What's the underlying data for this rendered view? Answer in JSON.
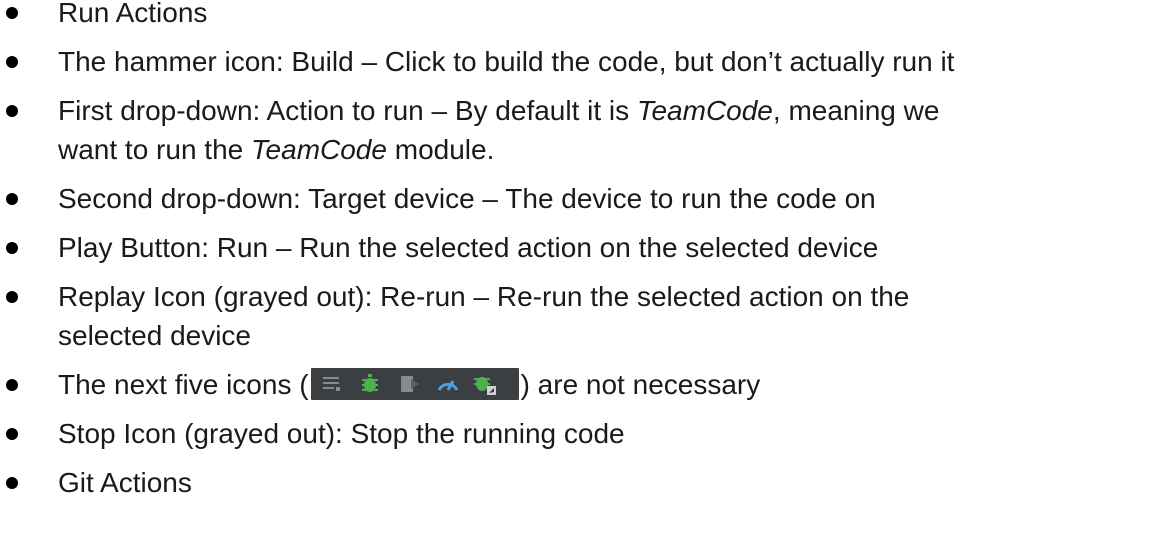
{
  "items": [
    {
      "text": "Run Actions"
    },
    {
      "text": "The hammer icon: Build – Click to build the code, but don’t actually run it"
    },
    {
      "pre": "First drop-down: Action to run – By default it is ",
      "em1": "TeamCode",
      "mid": ", meaning we",
      "line2_pre": "want to run the ",
      "em2": "TeamCode",
      "post": " module."
    },
    {
      "text": "Second drop-down: Target device – The device to run the code on"
    },
    {
      "text": "Play Button: Run – Run the selected action on the selected device"
    },
    {
      "line1": "Replay Icon (grayed out): Re-run – Re-run the selected action on the",
      "line2": "selected device"
    },
    {
      "pre": "The next five icons (",
      "post": ") are not necessary",
      "icons": [
        "list-run-icon",
        "debug-bug-icon",
        "attach-process-icon",
        "profiler-gauge-icon",
        "debug-attach-icon"
      ],
      "icon_bg": "#3c3f41",
      "icon_colors": [
        "#8a8a8a",
        "#4caf50",
        "#8a8a8a",
        "#4aa0e0",
        "#4caf50"
      ]
    },
    {
      "text": "Stop Icon (grayed out): Stop the running code"
    },
    {
      "text": "Git Actions"
    }
  ]
}
